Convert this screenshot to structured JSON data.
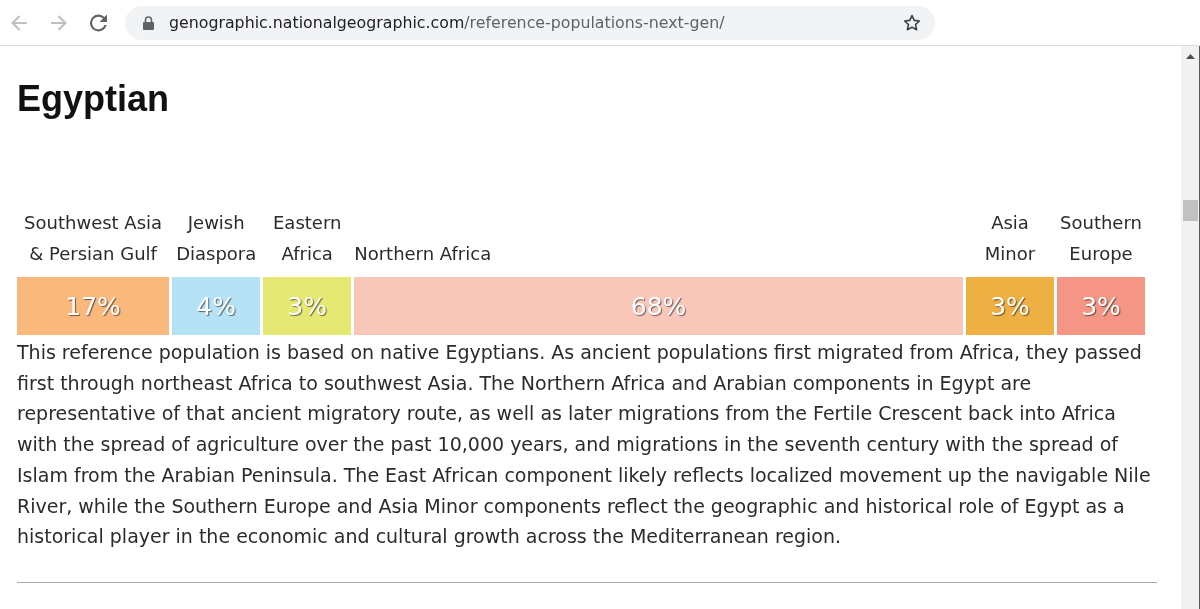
{
  "browser": {
    "nav_buttons": [
      {
        "kind": "back",
        "disabled": true
      },
      {
        "kind": "forward",
        "disabled": true
      },
      {
        "kind": "reload",
        "disabled": false
      }
    ],
    "address_bar": {
      "host": "genographic.nationalgeographic.com",
      "path": "/reference-populations-next-gen/"
    }
  },
  "population": {
    "title": "Egyptian",
    "segments": [
      {
        "label": "Southwest Asia & Persian Gulf",
        "percent": "17%",
        "color": "#fbb87c"
      },
      {
        "label": "Jewish Diaspora",
        "percent": "4%",
        "color": "#b6e2f6"
      },
      {
        "label": "Eastern Africa",
        "percent": "3%",
        "color": "#e5e873"
      },
      {
        "label": "Northern Africa",
        "percent": "68%",
        "color": "#f9c6ba"
      },
      {
        "label": "Asia Minor",
        "percent": "3%",
        "color": "#efb043"
      },
      {
        "label": "Southern Europe",
        "percent": "3%",
        "color": "#f49585"
      }
    ],
    "description": "This reference population is based on native Egyptians. As ancient populations first migrated from Africa, they passed first through northeast Africa to southwest Asia. The Northern Africa and Arabian components in Egypt are representative of that ancient migratory route, as well as later migrations from the Fertile Crescent back into Africa with the spread of agriculture over the past 10,000 years, and migrations in the seventh century with the spread of Islam from the Arabian Peninsula. The East African component likely reflects localized movement up the navigable Nile River, while the Southern Europe and Asia Minor components reflect the geographic and historical role of Egypt as a historical player in the economic and cultural growth across the Mediterranean region."
  }
}
